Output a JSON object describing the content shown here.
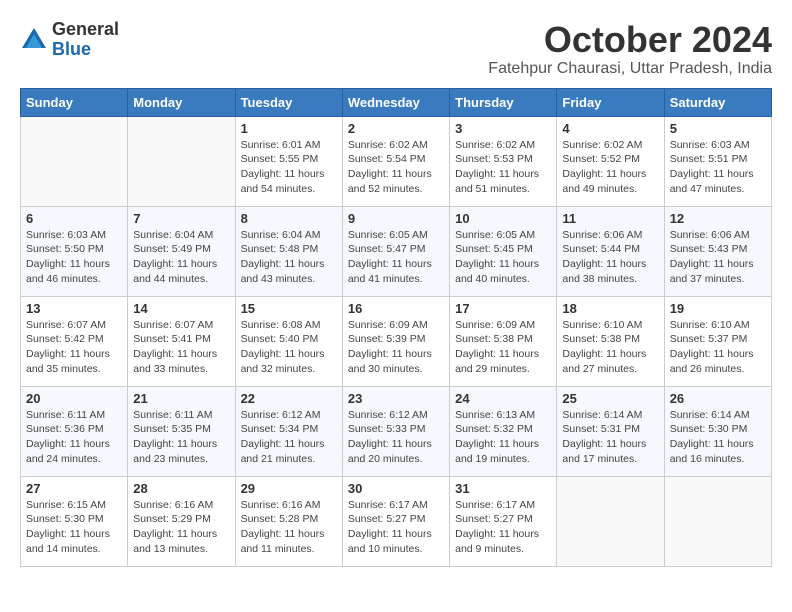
{
  "logo": {
    "general": "General",
    "blue": "Blue"
  },
  "header": {
    "month": "October 2024",
    "location": "Fatehpur Chaurasi, Uttar Pradesh, India"
  },
  "weekdays": [
    "Sunday",
    "Monday",
    "Tuesday",
    "Wednesday",
    "Thursday",
    "Friday",
    "Saturday"
  ],
  "weeks": [
    [
      {
        "day": "",
        "info": ""
      },
      {
        "day": "",
        "info": ""
      },
      {
        "day": "1",
        "info": "Sunrise: 6:01 AM\nSunset: 5:55 PM\nDaylight: 11 hours and 54 minutes."
      },
      {
        "day": "2",
        "info": "Sunrise: 6:02 AM\nSunset: 5:54 PM\nDaylight: 11 hours and 52 minutes."
      },
      {
        "day": "3",
        "info": "Sunrise: 6:02 AM\nSunset: 5:53 PM\nDaylight: 11 hours and 51 minutes."
      },
      {
        "day": "4",
        "info": "Sunrise: 6:02 AM\nSunset: 5:52 PM\nDaylight: 11 hours and 49 minutes."
      },
      {
        "day": "5",
        "info": "Sunrise: 6:03 AM\nSunset: 5:51 PM\nDaylight: 11 hours and 47 minutes."
      }
    ],
    [
      {
        "day": "6",
        "info": "Sunrise: 6:03 AM\nSunset: 5:50 PM\nDaylight: 11 hours and 46 minutes."
      },
      {
        "day": "7",
        "info": "Sunrise: 6:04 AM\nSunset: 5:49 PM\nDaylight: 11 hours and 44 minutes."
      },
      {
        "day": "8",
        "info": "Sunrise: 6:04 AM\nSunset: 5:48 PM\nDaylight: 11 hours and 43 minutes."
      },
      {
        "day": "9",
        "info": "Sunrise: 6:05 AM\nSunset: 5:47 PM\nDaylight: 11 hours and 41 minutes."
      },
      {
        "day": "10",
        "info": "Sunrise: 6:05 AM\nSunset: 5:45 PM\nDaylight: 11 hours and 40 minutes."
      },
      {
        "day": "11",
        "info": "Sunrise: 6:06 AM\nSunset: 5:44 PM\nDaylight: 11 hours and 38 minutes."
      },
      {
        "day": "12",
        "info": "Sunrise: 6:06 AM\nSunset: 5:43 PM\nDaylight: 11 hours and 37 minutes."
      }
    ],
    [
      {
        "day": "13",
        "info": "Sunrise: 6:07 AM\nSunset: 5:42 PM\nDaylight: 11 hours and 35 minutes."
      },
      {
        "day": "14",
        "info": "Sunrise: 6:07 AM\nSunset: 5:41 PM\nDaylight: 11 hours and 33 minutes."
      },
      {
        "day": "15",
        "info": "Sunrise: 6:08 AM\nSunset: 5:40 PM\nDaylight: 11 hours and 32 minutes."
      },
      {
        "day": "16",
        "info": "Sunrise: 6:09 AM\nSunset: 5:39 PM\nDaylight: 11 hours and 30 minutes."
      },
      {
        "day": "17",
        "info": "Sunrise: 6:09 AM\nSunset: 5:38 PM\nDaylight: 11 hours and 29 minutes."
      },
      {
        "day": "18",
        "info": "Sunrise: 6:10 AM\nSunset: 5:38 PM\nDaylight: 11 hours and 27 minutes."
      },
      {
        "day": "19",
        "info": "Sunrise: 6:10 AM\nSunset: 5:37 PM\nDaylight: 11 hours and 26 minutes."
      }
    ],
    [
      {
        "day": "20",
        "info": "Sunrise: 6:11 AM\nSunset: 5:36 PM\nDaylight: 11 hours and 24 minutes."
      },
      {
        "day": "21",
        "info": "Sunrise: 6:11 AM\nSunset: 5:35 PM\nDaylight: 11 hours and 23 minutes."
      },
      {
        "day": "22",
        "info": "Sunrise: 6:12 AM\nSunset: 5:34 PM\nDaylight: 11 hours and 21 minutes."
      },
      {
        "day": "23",
        "info": "Sunrise: 6:12 AM\nSunset: 5:33 PM\nDaylight: 11 hours and 20 minutes."
      },
      {
        "day": "24",
        "info": "Sunrise: 6:13 AM\nSunset: 5:32 PM\nDaylight: 11 hours and 19 minutes."
      },
      {
        "day": "25",
        "info": "Sunrise: 6:14 AM\nSunset: 5:31 PM\nDaylight: 11 hours and 17 minutes."
      },
      {
        "day": "26",
        "info": "Sunrise: 6:14 AM\nSunset: 5:30 PM\nDaylight: 11 hours and 16 minutes."
      }
    ],
    [
      {
        "day": "27",
        "info": "Sunrise: 6:15 AM\nSunset: 5:30 PM\nDaylight: 11 hours and 14 minutes."
      },
      {
        "day": "28",
        "info": "Sunrise: 6:16 AM\nSunset: 5:29 PM\nDaylight: 11 hours and 13 minutes."
      },
      {
        "day": "29",
        "info": "Sunrise: 6:16 AM\nSunset: 5:28 PM\nDaylight: 11 hours and 11 minutes."
      },
      {
        "day": "30",
        "info": "Sunrise: 6:17 AM\nSunset: 5:27 PM\nDaylight: 11 hours and 10 minutes."
      },
      {
        "day": "31",
        "info": "Sunrise: 6:17 AM\nSunset: 5:27 PM\nDaylight: 11 hours and 9 minutes."
      },
      {
        "day": "",
        "info": ""
      },
      {
        "day": "",
        "info": ""
      }
    ]
  ]
}
